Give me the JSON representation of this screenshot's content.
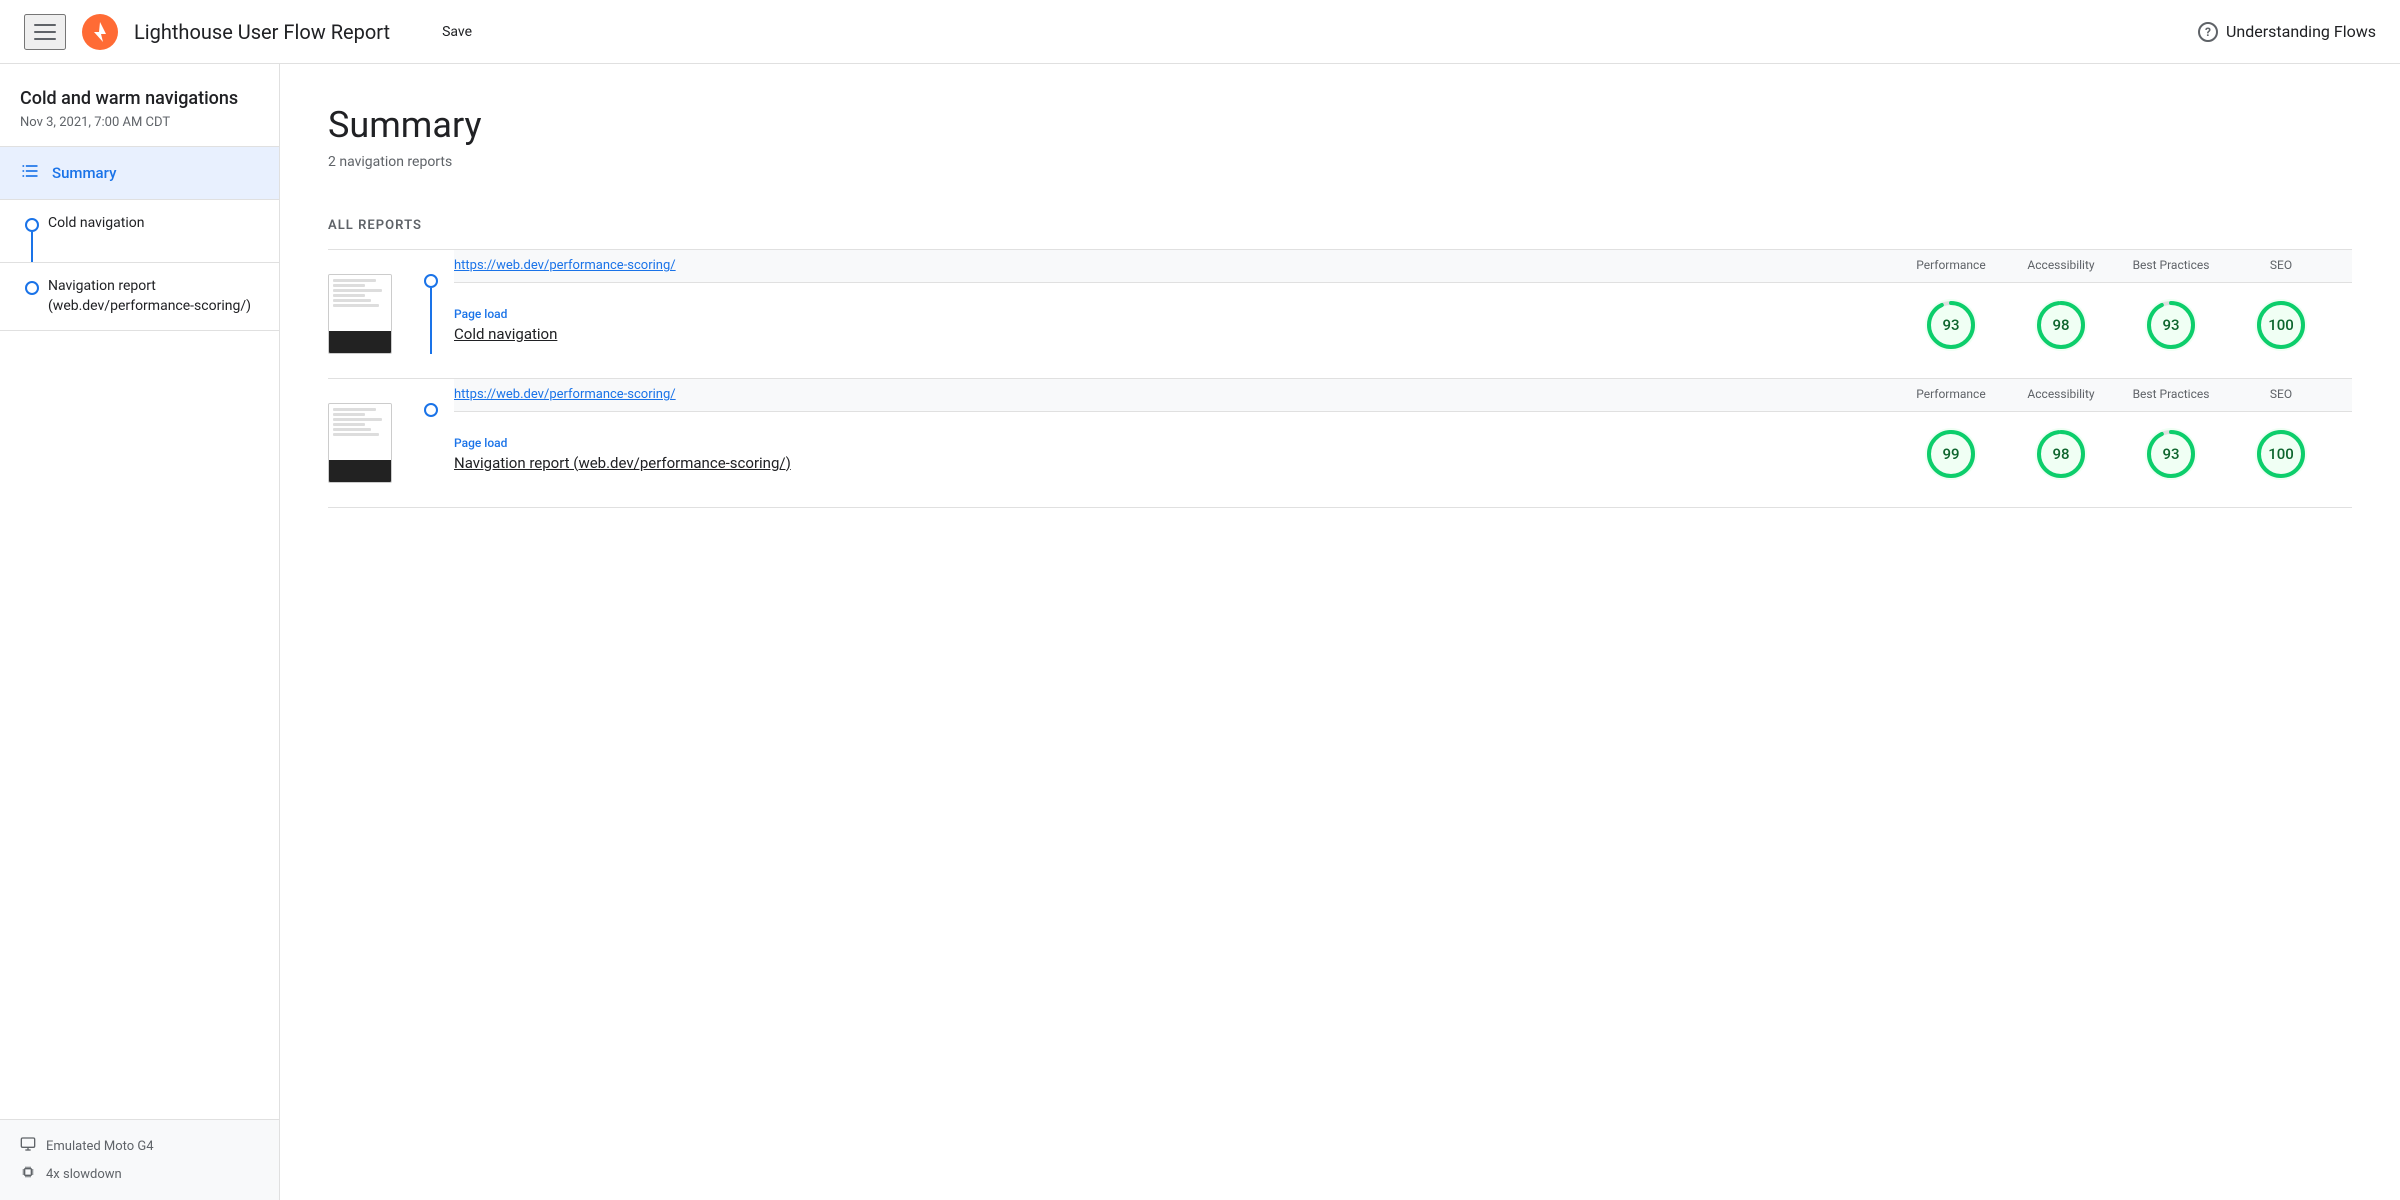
{
  "header": {
    "menu_icon": "menu",
    "logo_alt": "Lighthouse logo",
    "title": "Lighthouse User Flow Report",
    "save_label": "Save",
    "help_icon": "?",
    "understanding_flows": "Understanding Flows"
  },
  "sidebar": {
    "project_title": "Cold and warm navigations",
    "project_date": "Nov 3, 2021, 7:00 AM CDT",
    "summary_label": "Summary",
    "nav_items": [
      {
        "label": "Cold navigation",
        "sub_label": null
      },
      {
        "label": "Navigation report\n(web.dev/performance-scoring/)",
        "sub_label": null
      }
    ],
    "footer_items": [
      {
        "icon": "monitor",
        "label": "Emulated Moto G4"
      },
      {
        "icon": "cpu",
        "label": "4x slowdown"
      }
    ]
  },
  "content": {
    "summary_title": "Summary",
    "summary_subtitle": "2 navigation reports",
    "all_reports_label": "ALL REPORTS",
    "reports": [
      {
        "url": "https://web.dev/performance-scoring/",
        "type_label": "Page load",
        "name": "Cold navigation",
        "scores": {
          "performance": 93,
          "accessibility": 98,
          "best_practices": 93,
          "seo": 100
        }
      },
      {
        "url": "https://web.dev/performance-scoring/",
        "type_label": "Page load",
        "name": "Navigation report (web.dev/performance-scoring/)",
        "scores": {
          "performance": 99,
          "accessibility": 98,
          "best_practices": 93,
          "seo": 100
        }
      }
    ],
    "col_headers": [
      "Performance",
      "Accessibility",
      "Best Practices",
      "SEO"
    ]
  }
}
